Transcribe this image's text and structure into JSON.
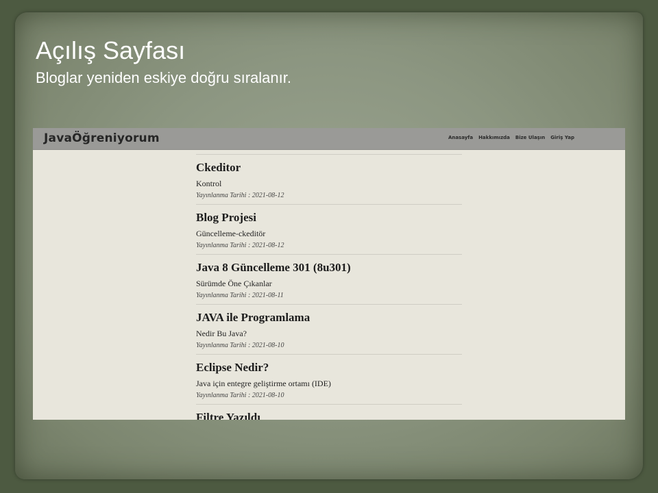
{
  "slide": {
    "title": "Açılış Sayfası",
    "subtitle": "Bloglar yeniden eskiye doğru sıralanır."
  },
  "navbar": {
    "brand": "JavaÖğreniyorum",
    "links": [
      "Anasayfa",
      "Hakkımızda",
      "Bize Ulaşın",
      "Giriş Yap"
    ]
  },
  "meta_label": "Yayınlanma Tarihi :",
  "posts": [
    {
      "title": "Ckeditor",
      "subtitle": "Kontrol",
      "date": "2021-08-12"
    },
    {
      "title": "Blog Projesi",
      "subtitle": "Güncelleme-ckeditör",
      "date": "2021-08-12"
    },
    {
      "title": "Java 8 Güncelleme 301 (8u301)",
      "subtitle": "Sürümde Öne Çıkanlar",
      "date": "2021-08-11"
    },
    {
      "title": "JAVA ile Programlama",
      "subtitle": "Nedir Bu Java?",
      "date": "2021-08-10"
    },
    {
      "title": "Eclipse Nedir?",
      "subtitle": "Java için entegre geliştirme ortamı (IDE)",
      "date": "2021-08-10"
    },
    {
      "title": "Filtre Yazıldı"
    }
  ],
  "colors": {
    "page_background": "#e8e6dc",
    "navbar": "#9a9a97",
    "slide_background": "#8c9681"
  }
}
